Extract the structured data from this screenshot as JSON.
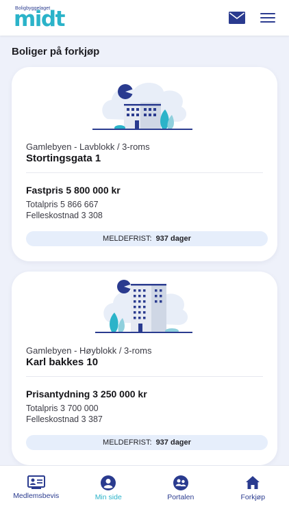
{
  "header": {
    "logo_small": "Boligbyggelaget",
    "logo_main": "midt"
  },
  "page": {
    "section_title": "Boliger på forkjøp"
  },
  "listings": [
    {
      "meta": "Gamlebyen - Lavblokk / 3-roms",
      "address": "Stortingsgata 1",
      "price": "Fastpris 5 800 000 kr",
      "total": "Totalpris 5 866 667",
      "shared_cost": "Felleskostnad 3 308",
      "deadline_label": "MELDEFRIST:",
      "deadline_value": "937 dager"
    },
    {
      "meta": "Gamlebyen - Høyblokk / 3-roms",
      "address": "Karl bakkes 10",
      "price": "Prisantydning 3 250 000 kr",
      "total": "Totalpris 3 700 000",
      "shared_cost": "Felleskostnad 3 387",
      "deadline_label": "MELDEFRIST:",
      "deadline_value": "937 dager"
    }
  ],
  "nav": [
    {
      "label": "Medlemsbevis",
      "icon": "id-card-icon"
    },
    {
      "label": "Min side",
      "icon": "user-icon"
    },
    {
      "label": "Portalen",
      "icon": "group-icon"
    },
    {
      "label": "Forkjøp",
      "icon": "home-icon"
    }
  ],
  "colors": {
    "brand_dark": "#2a3b8f",
    "brand_teal": "#2bb3c9",
    "background": "#eef1fa"
  }
}
